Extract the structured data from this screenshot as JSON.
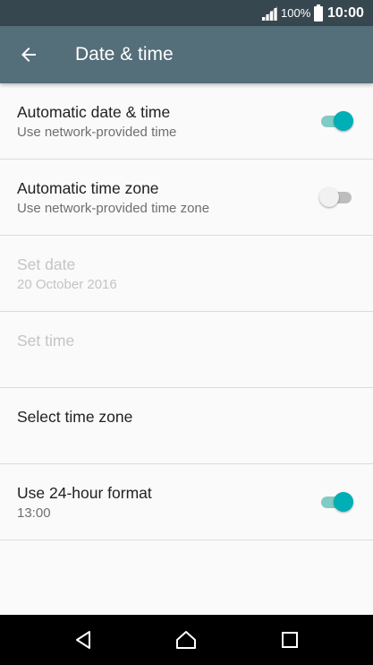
{
  "status_bar": {
    "battery_percent": "100%",
    "time": "10:00",
    "icons": [
      "signal-icon",
      "battery-icon"
    ]
  },
  "app_bar": {
    "title": "Date & time",
    "back_icon": "arrow-left-icon"
  },
  "settings": [
    {
      "key": "auto_date_time",
      "title": "Automatic date & time",
      "subtitle": "Use network-provided time",
      "toggle": true,
      "enabled": true
    },
    {
      "key": "auto_time_zone",
      "title": "Automatic time zone",
      "subtitle": "Use network-provided time zone",
      "toggle": false,
      "enabled": true
    },
    {
      "key": "set_date",
      "title": "Set date",
      "subtitle": "20 October 2016",
      "enabled": false
    },
    {
      "key": "set_time",
      "title": "Set time",
      "enabled": false
    },
    {
      "key": "select_time_zone",
      "title": "Select time zone",
      "enabled": true
    },
    {
      "key": "use_24_hour",
      "title": "Use 24-hour format",
      "subtitle": "13:00",
      "toggle": true,
      "enabled": true
    }
  ],
  "nav_bar": {
    "icons": [
      "back-triangle-icon",
      "home-icon",
      "recents-square-icon"
    ]
  },
  "colors": {
    "status_bar": "#37474f",
    "app_bar": "#546e7a",
    "accent": "#00aeb5",
    "background": "#fafafa"
  }
}
